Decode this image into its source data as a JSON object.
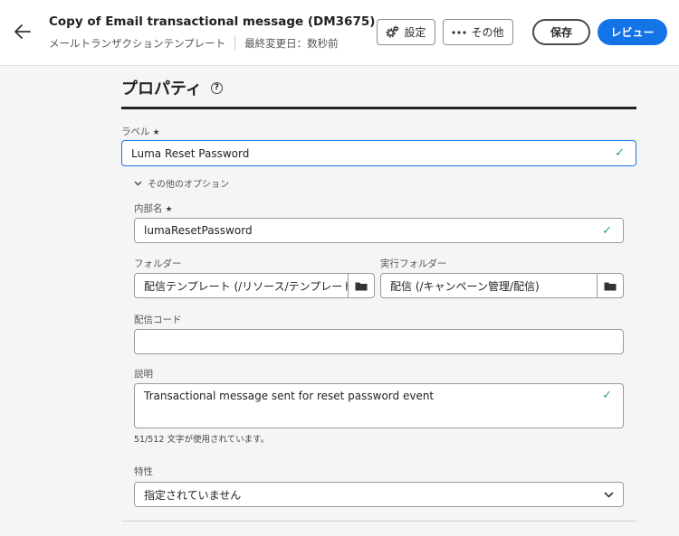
{
  "header": {
    "title": "Copy of Email transactional message (DM3675)",
    "type_label": "メールトランザクションテンプレート",
    "last_modified": "最終変更日：数秒前",
    "settings_label": "設定",
    "more_label": "その他",
    "save_label": "保存",
    "review_label": "レビュー"
  },
  "properties": {
    "heading": "プロパティ",
    "label": {
      "label": "ラベル",
      "required_mark": "★",
      "value": "Luma Reset Password"
    },
    "options_toggle": "その他のオプション",
    "internal_name": {
      "label": "内部名",
      "required_mark": "★",
      "value": "lumaResetPassword"
    },
    "folder": {
      "label": "フォルダー",
      "value": "配信テンプレート (/リソース/テンプレート/配信テンプレート)"
    },
    "execution_folder": {
      "label": "実行フォルダー",
      "value": "配信 (/キャンペーン管理/配信)"
    },
    "delivery_code": {
      "label": "配信コード",
      "value": ""
    },
    "description": {
      "label": "説明",
      "value": "Transactional message sent for reset password event",
      "counter": "51/512 文字が使用されています。"
    },
    "nature": {
      "label": "特性",
      "value": "指定されていません"
    }
  },
  "colors": {
    "accent": "#1473e6",
    "valid": "#2d9d78"
  }
}
